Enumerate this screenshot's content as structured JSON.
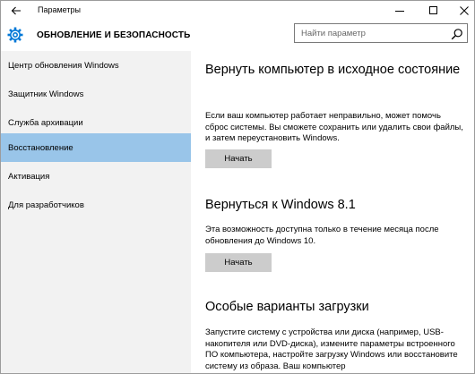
{
  "window": {
    "title": "Параметры"
  },
  "header": {
    "title": "ОБНОВЛЕНИЕ И БЕЗОПАСНОСТЬ",
    "search_placeholder": "Найти параметр"
  },
  "sidebar": {
    "items": [
      {
        "label": "Центр обновления Windows"
      },
      {
        "label": "Защитник Windows"
      },
      {
        "label": "Служба архивации"
      },
      {
        "label": "Восстановление",
        "selected": true
      },
      {
        "label": "Активация"
      },
      {
        "label": "Для разработчиков"
      }
    ]
  },
  "sections": [
    {
      "title": "Вернуть компьютер в исходное состояние",
      "description": "Если ваш компьютер работает неправильно, может помочь сброс системы. Вы сможете сохранить или удалить свои файлы, и затем переустановить Windows.",
      "button": "Начать"
    },
    {
      "title": "Вернуться к Windows 8.1",
      "description": "Эта возможность доступна только в течение месяца после обновления до Windows 10.",
      "button": "Начать"
    },
    {
      "title": "Особые варианты загрузки",
      "description": "Запустите систему с устройства или диска (например, USB-накопителя или DVD-диска), измените параметры встроенного ПО компьютера, настройте загрузку Windows или восстановите систему из образа. Ваш компьютер"
    }
  ],
  "colors": {
    "accent": "#0078d7",
    "selected_bg": "#99c5e9",
    "sidebar_bg": "#f2f2f2",
    "button_bg": "#cccccc"
  },
  "icons": {
    "back": "back-arrow-icon",
    "settings": "gear-icon",
    "search": "search-icon",
    "minimize": "minimize-icon",
    "maximize": "maximize-icon",
    "close": "close-icon"
  }
}
